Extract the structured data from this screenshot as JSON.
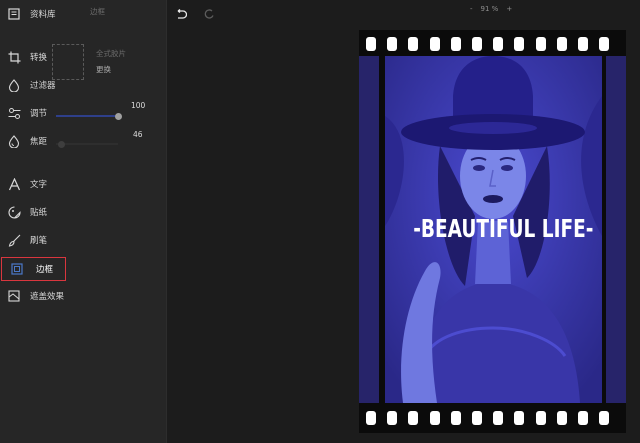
{
  "sidebar": {
    "library": "资料库",
    "menu_header": "边框",
    "convert": "转换",
    "filter": "过滤器",
    "adjust": "调节",
    "focus": "焦距",
    "text": "文字",
    "sticker": "贴纸",
    "brush": "刷笔",
    "border": "边框",
    "overlay": "遮盖效果"
  },
  "convert_panel": {
    "placeholder": "全式胶片",
    "replace": "更换"
  },
  "adjust_panel": {
    "value": "100",
    "level": 1.0
  },
  "focus_panel": {
    "value": "46",
    "level": 0.46
  },
  "toolbar": {
    "zoom_minus": "-",
    "zoom_value": "91 %",
    "zoom_plus": "+"
  },
  "canvas": {
    "caption": "-BEAUTIFUL LIFE-"
  },
  "colors": {
    "accent_border": "#d9363e",
    "tint": "#3a37b8",
    "film": "#0b0b0b"
  }
}
